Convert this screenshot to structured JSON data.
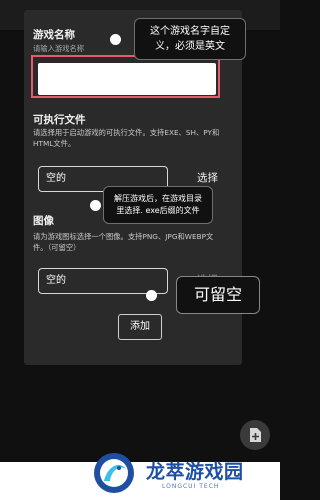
{
  "dialog": {
    "game_name": {
      "title": "游戏名称",
      "placeholder": "请输入游戏名称"
    },
    "executable": {
      "title": "可执行文件",
      "description_line1": "请选择用于启动游戏的可执行文件。支持EXE、SH、PY和",
      "description_line2": "HTML文件。",
      "value": "空的",
      "select_label": "选择"
    },
    "image": {
      "title": "图像",
      "description_line1": "请为游戏图标选择一个图像。支持PNG、JPG和WEBP文",
      "description_line2": "件。（可留空）",
      "value": "空的",
      "select_label": "选择"
    },
    "add_label": "添加"
  },
  "tips": {
    "name_tip_line1": "这个游戏名字自定",
    "name_tip_line2": "义，必须是英文",
    "exe_tip_line1": "解压游戏后，在游戏目录",
    "exe_tip_line2": "里选择. exe后缀的文件",
    "image_tip": "可留空"
  },
  "watermark": {
    "title": "龙萃游戏园",
    "subtitle": "LONGCUI TECH"
  },
  "colors": {
    "dialog_bg": "#2a2a2a",
    "highlight_red": "#e65a6d",
    "watermark_blue": "#1f4fa3"
  },
  "icons": {
    "fab": "add-file-icon",
    "watermark_logo": "dragon-logo-icon"
  }
}
